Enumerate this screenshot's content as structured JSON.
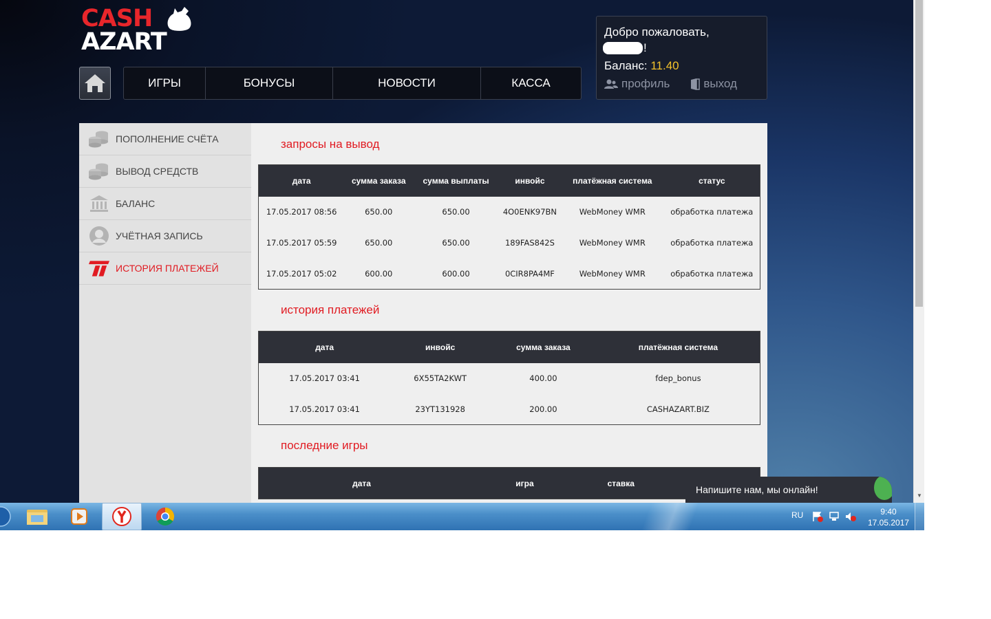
{
  "logo": {
    "line1": "CASH",
    "line2": "AZART"
  },
  "nav": [
    {
      "label": "ИГРЫ"
    },
    {
      "label": "БОНУСЫ"
    },
    {
      "label": "НОВОСТИ"
    },
    {
      "label": "КАССА"
    }
  ],
  "welcome": {
    "greeting": "Добро пожаловать,",
    "excl": "!",
    "balance_label": "Баланс:",
    "balance_value": "11.40",
    "profile": "профиль",
    "logout": "выход"
  },
  "sidebar": [
    {
      "label": "ПОПОЛНЕНИЕ СЧЁТА",
      "icon": "coins-icon"
    },
    {
      "label": "ВЫВОД СРЕДСТВ",
      "icon": "coins-icon"
    },
    {
      "label": "БАЛАНС",
      "icon": "bank-icon"
    },
    {
      "label": "УЧЁТНАЯ ЗАПИСЬ",
      "icon": "user-icon"
    },
    {
      "label": "ИСТОРИЯ ПЛАТЕЖЕЙ",
      "icon": "history-icon",
      "active": true
    }
  ],
  "withdrawals": {
    "title": "запросы на вывод",
    "headers": [
      "дата",
      "сумма заказа",
      "сумма выплаты",
      "инвойс",
      "платёжная система",
      "статус"
    ],
    "rows": [
      [
        "17.05.2017 08:56",
        "650.00",
        "650.00",
        "4O0ENK97BN",
        "WebMoney WMR",
        "обработка платежа"
      ],
      [
        "17.05.2017 05:59",
        "650.00",
        "650.00",
        "189FAS842S",
        "WebMoney WMR",
        "обработка платежа"
      ],
      [
        "17.05.2017 05:02",
        "600.00",
        "600.00",
        "0CIR8PA4MF",
        "WebMoney WMR",
        "обработка платежа"
      ]
    ]
  },
  "payments": {
    "title": "история платежей",
    "headers": [
      "дата",
      "инвойс",
      "сумма заказа",
      "платёжная система"
    ],
    "rows": [
      [
        "17.05.2017 03:41",
        "6X55TA2KWT",
        "400.00",
        "fdep_bonus"
      ],
      [
        "17.05.2017 03:41",
        "23YT131928",
        "200.00",
        "CASHAZART.BIZ"
      ]
    ]
  },
  "games": {
    "title": "последние игры",
    "headers": [
      "дата",
      "игра",
      "ставка"
    ]
  },
  "chat": {
    "label": "Напишите нам, мы онлайн!"
  },
  "taskbar": {
    "apps": [
      "explorer-icon",
      "media-player-icon",
      "yandex-browser-icon",
      "chrome-icon"
    ],
    "lang": "RU",
    "time": "9:40",
    "date": "17.05.2017"
  },
  "colors": {
    "accent_red": "#e11b22",
    "balance_gold": "#f4c22b",
    "table_header": "#2e3038"
  }
}
